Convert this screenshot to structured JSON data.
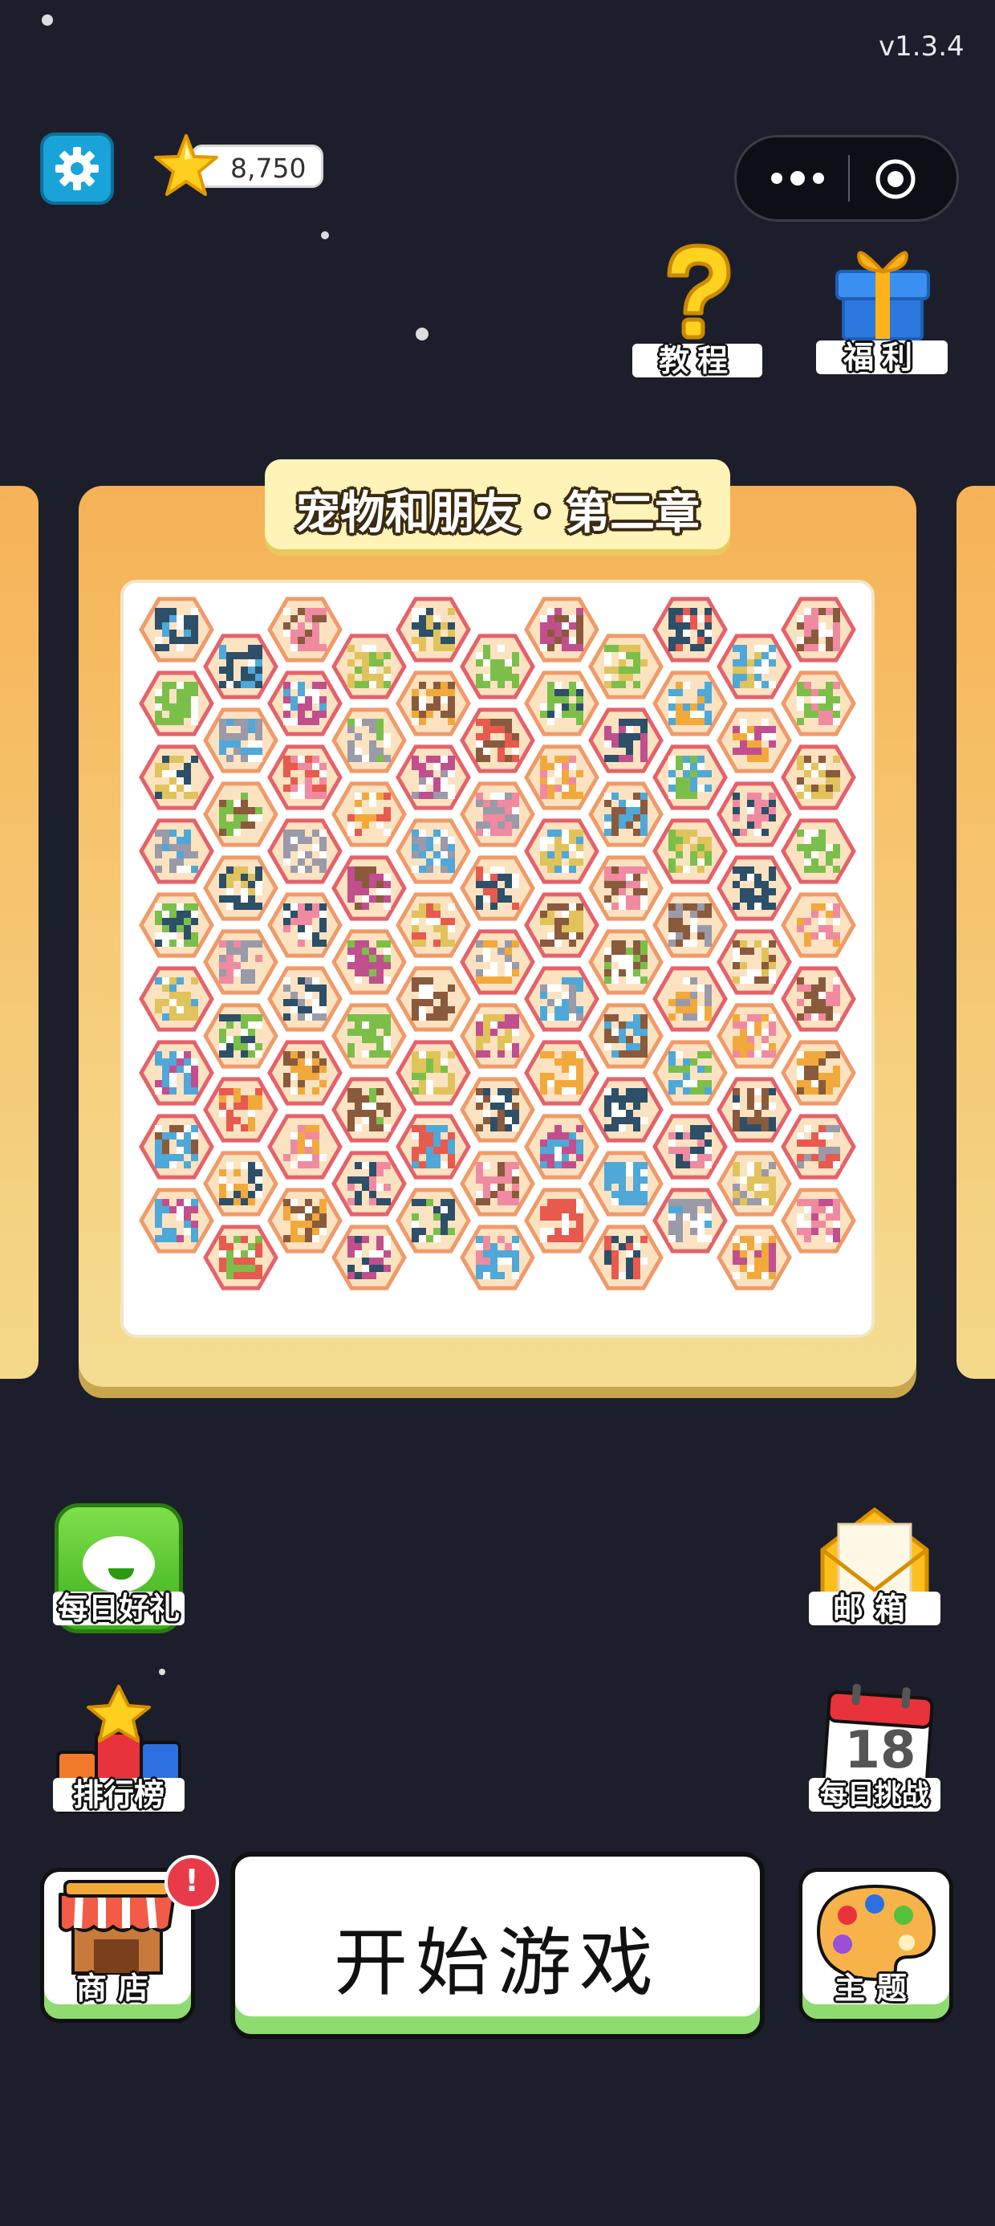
{
  "status": {
    "version": "v1.3.4"
  },
  "header": {
    "coins": "8,750",
    "tutorial_label": "教程",
    "welfare_label": "福利"
  },
  "level": {
    "title": "宠物和朋友・第二章",
    "tile_palette": [
      "#e75a4d",
      "#4fa8d8",
      "#f2a93b",
      "#7bbf4a",
      "#c14f8e",
      "#2d4f68",
      "#e0c35a",
      "#8a5a3c",
      "#9a9aa8",
      "#f08aa0"
    ]
  },
  "side_menu": {
    "daily_gift": "每日好礼",
    "mailbox": "邮箱",
    "leaderboard": "排行榜",
    "daily_challenge": "每日挑战",
    "calendar_day": "18"
  },
  "bottom_bar": {
    "shop": "商店",
    "shop_badge": "!",
    "start": "开始游戏",
    "theme": "主题"
  },
  "colors": {
    "background": "#1d1e2b",
    "card": "#f5b156",
    "start_accent": "#8edb70"
  }
}
